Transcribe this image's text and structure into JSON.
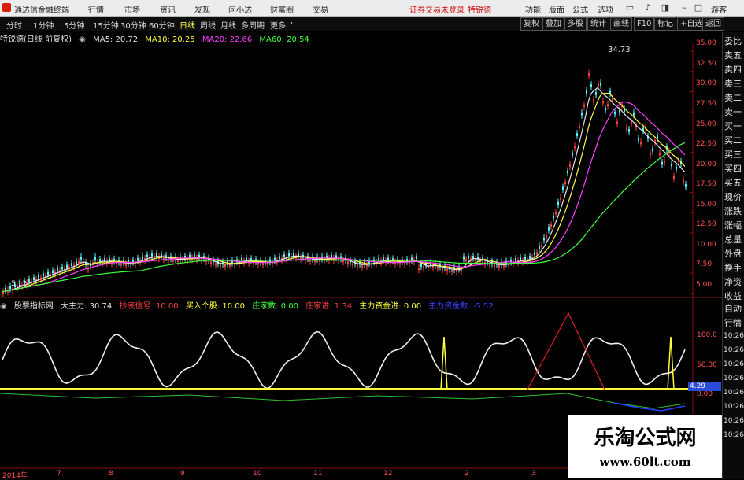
{
  "app_title": "通达信金融终端",
  "menu": [
    "行情",
    "市场",
    "资讯",
    "发现",
    "问小达",
    "财富圈",
    "交易"
  ],
  "login_status": "证券交易未登录",
  "stock_name_top": "特锐德",
  "right_menu": [
    "功能",
    "版面",
    "公式",
    "选项"
  ],
  "right_brand": "游客",
  "periods": [
    "分时",
    "1分钟",
    "5分钟",
    "15分钟",
    "30分钟",
    "60分钟",
    "日线",
    "周线",
    "月线",
    "多周期",
    "更多"
  ],
  "active_period": "日线",
  "toolbar_right": [
    "复权",
    "叠加",
    "多股",
    "统计",
    "画线",
    "F10",
    "标记",
    "+自选",
    "返回"
  ],
  "main_legend": {
    "title": "特锐德(日线 前复权)",
    "ma5": "MA5: 20.72",
    "ma10": "MA10: 20.25",
    "ma20": "MA20: 22.66",
    "ma60": "MA60: 20.54"
  },
  "price_axis": [
    "35.00",
    "32.50",
    "30.00",
    "27.50",
    "25.00",
    "22.50",
    "20.00",
    "17.50",
    "15.00",
    "12.50",
    "10.00",
    "7.50",
    "5.00"
  ],
  "high_label": "34.73",
  "low_label": "5.12",
  "indicator_legend": {
    "name": "股票指标网",
    "main_force": "大主力: 30.74",
    "bottom_signal": "抄底信号: 10.00",
    "buy_stock": "买入个股: 10.00",
    "dealer_count": "庄家数: 0.00",
    "dealer_in": "庄家进: 1.34",
    "fund_in": "主力资金进: 0.00",
    "fund_count": "主力资金数: -5.52"
  },
  "indicator_axis": [
    "100.0",
    "50.00",
    "0.00"
  ],
  "indicator_marker": "4.29",
  "sidebar": [
    "委比",
    "卖五",
    "卖四",
    "卖三",
    "卖二",
    "卖一",
    "买一",
    "买二",
    "买三",
    "买四",
    "买五",
    "现价",
    "涨跌",
    "涨幅",
    "总量",
    "外盘",
    "换手",
    "净资",
    "收益"
  ],
  "sidebar_lower": [
    "自动",
    "行情"
  ],
  "times": [
    "10:26",
    "10:26",
    "10:26",
    "10:26",
    "10:26",
    "10:26",
    "10:26",
    "10:26"
  ],
  "x_dates": [
    "2014年",
    "7",
    "8",
    "9",
    "10",
    "11",
    "12",
    "2",
    "3",
    "4",
    "5"
  ],
  "watermark": {
    "line1": "乐淘公式网",
    "line2": "www.60lt.com"
  },
  "colors": {
    "up": "#ff3c3c",
    "down": "#54ffff",
    "ma5": "#e8e8e8",
    "ma10": "#ffff40",
    "ma20": "#ff40ff",
    "ma60": "#40ff40",
    "axis": "#ff5050"
  }
}
